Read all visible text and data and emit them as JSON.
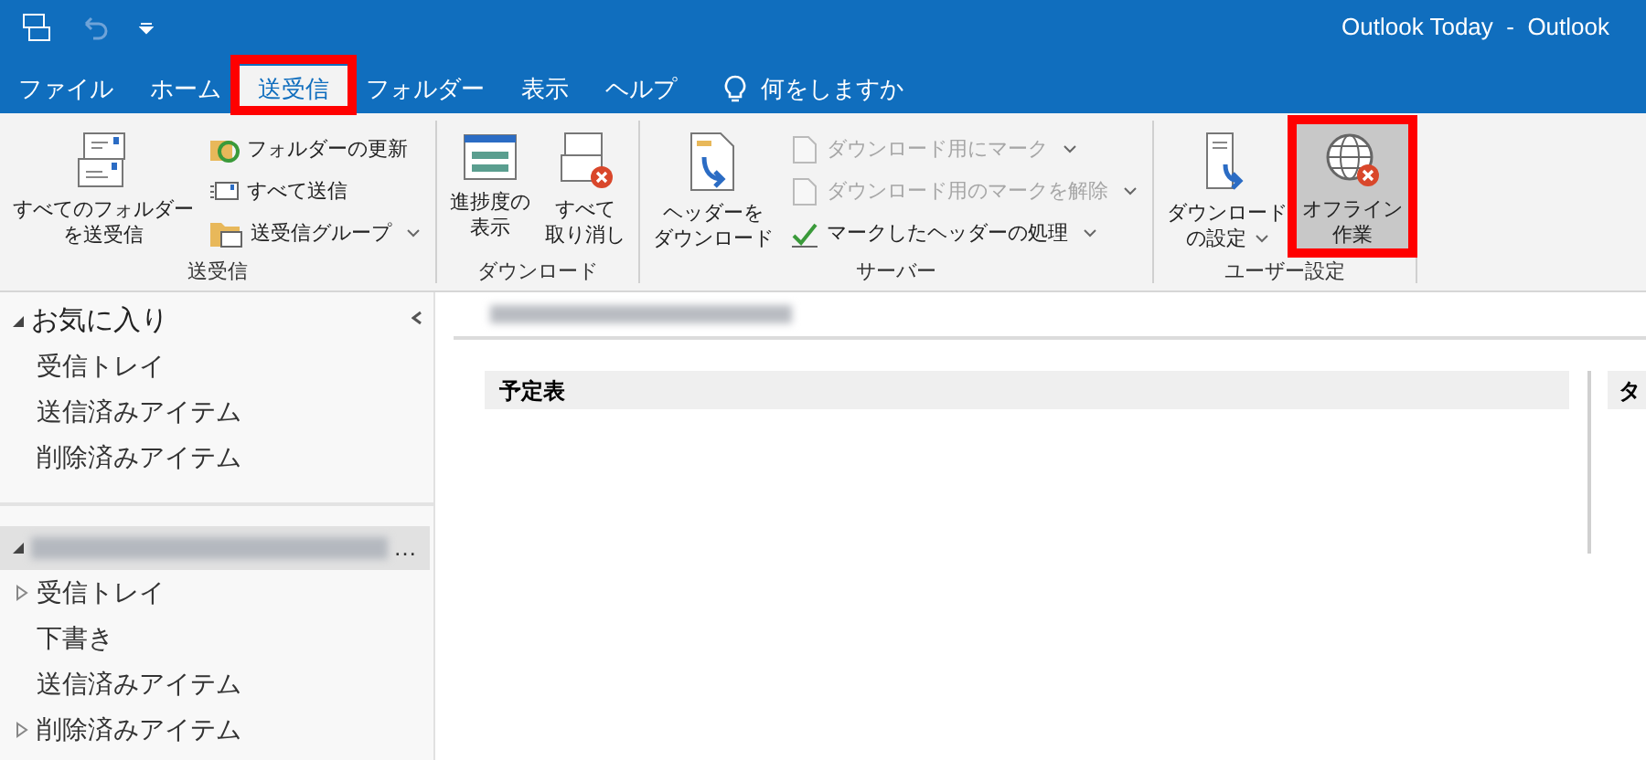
{
  "window": {
    "title": "Outlook Today  -  Outlook"
  },
  "tabs": [
    {
      "label": "ファイル",
      "selected": false,
      "highlighted": false
    },
    {
      "label": "ホーム",
      "selected": false,
      "highlighted": false
    },
    {
      "label": "送受信",
      "selected": true,
      "highlighted": true
    },
    {
      "label": "フォルダー",
      "selected": false,
      "highlighted": false
    },
    {
      "label": "表示",
      "selected": false,
      "highlighted": false
    },
    {
      "label": "ヘルプ",
      "selected": false,
      "highlighted": false
    }
  ],
  "tell_me": {
    "placeholder": "何をしますか"
  },
  "ribbon": [
    {
      "label": "送受信",
      "controls": [
        {
          "kind": "large",
          "lines": [
            "すべてのフォルダー",
            "を送受信"
          ],
          "dropdown": false,
          "pressed": false,
          "highlighted": false
        },
        {
          "kind": "stack",
          "items": [
            {
              "label": "フォルダーの更新",
              "dropdown": false,
              "disabled": false
            },
            {
              "label": "すべて送信",
              "dropdown": false,
              "disabled": false
            },
            {
              "label": "送受信グループ",
              "dropdown": true,
              "disabled": false
            }
          ]
        }
      ]
    },
    {
      "label": "ダウンロード",
      "controls": [
        {
          "kind": "large",
          "lines": [
            "進捗度の",
            "表示"
          ],
          "dropdown": false,
          "pressed": false,
          "highlighted": false
        },
        {
          "kind": "large",
          "lines": [
            "すべて",
            "取り消し"
          ],
          "dropdown": false,
          "pressed": false,
          "highlighted": false
        }
      ]
    },
    {
      "label": "サーバー",
      "controls": [
        {
          "kind": "large",
          "lines": [
            "ヘッダーを",
            "ダウンロード"
          ],
          "dropdown": false,
          "pressed": false,
          "highlighted": false
        },
        {
          "kind": "stack",
          "items": [
            {
              "label": "ダウンロード用にマーク",
              "dropdown": true,
              "disabled": true
            },
            {
              "label": "ダウンロード用のマークを解除",
              "dropdown": true,
              "disabled": true
            },
            {
              "label": "マークしたヘッダーの処理",
              "dropdown": true,
              "disabled": false
            }
          ]
        }
      ]
    },
    {
      "label": "ユーザー設定",
      "controls": [
        {
          "kind": "large",
          "lines": [
            "ダウンロード",
            "の設定"
          ],
          "dropdown": true,
          "pressed": false,
          "highlighted": false
        },
        {
          "kind": "large",
          "lines": [
            "オフライン",
            "作業"
          ],
          "dropdown": false,
          "pressed": true,
          "highlighted": true
        }
      ]
    }
  ],
  "folder_pane": {
    "sections": [
      {
        "label": "お気に入り",
        "expanded": true,
        "redacted": false,
        "selected": false,
        "items": [
          {
            "label": "受信トレイ",
            "has_children": false
          },
          {
            "label": "送信済みアイテム",
            "has_children": false
          },
          {
            "label": "削除済みアイテム",
            "has_children": false
          }
        ]
      },
      {
        "label": "…",
        "expanded": true,
        "redacted": true,
        "selected": true,
        "items": [
          {
            "label": "受信トレイ",
            "has_children": true
          },
          {
            "label": "下書き",
            "has_children": false
          },
          {
            "label": "送信済みアイテム",
            "has_children": false
          },
          {
            "label": "削除済みアイテム",
            "has_children": true
          }
        ]
      }
    ]
  },
  "today": {
    "columns": [
      "予定表",
      "タ"
    ]
  }
}
